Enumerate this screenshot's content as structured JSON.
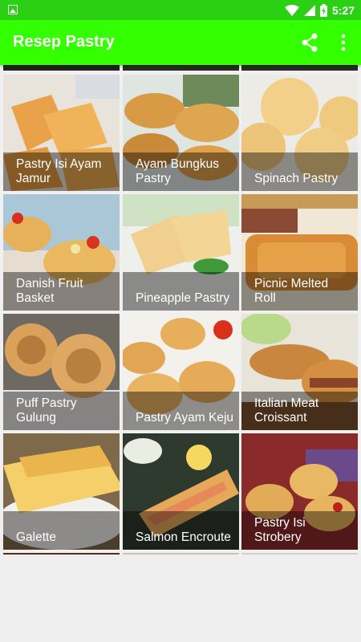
{
  "status_bar": {
    "time": "5:27"
  },
  "app_bar": {
    "title": "Resep Pastry"
  },
  "recipes": [
    {
      "label": "Pastry Isi Ayam Jamur"
    },
    {
      "label": "Ayam Bungkus Pastry"
    },
    {
      "label": "Spinach Pastry"
    },
    {
      "label": "Danish Fruit Basket"
    },
    {
      "label": "Pineapple Pastry"
    },
    {
      "label": "Picnic Melted Roll"
    },
    {
      "label": "Puff Pastry Gulung"
    },
    {
      "label": "Pastry Ayam Keju"
    },
    {
      "label": "Italian Meat Croissant"
    },
    {
      "label": "Galette"
    },
    {
      "label": "Salmon Encroute"
    },
    {
      "label": "Pastry Isi Strobery"
    }
  ],
  "colors": {
    "status_bar": "#2bd014",
    "app_bar": "#33ff00"
  }
}
